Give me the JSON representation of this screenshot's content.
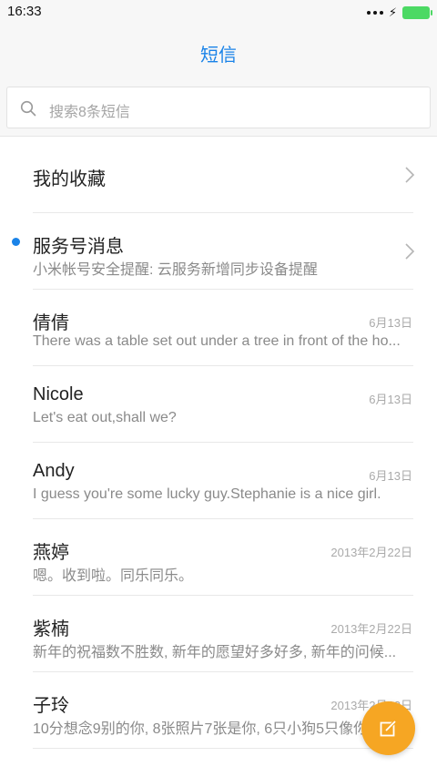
{
  "status_bar": {
    "time": "16:33",
    "battery_color": "#4cd964"
  },
  "header": {
    "title": "短信",
    "accent_color": "#1a83e8"
  },
  "search": {
    "placeholder": "搜索8条短信"
  },
  "folders": [
    {
      "name": "我的收藏"
    },
    {
      "name": "服务号消息",
      "preview": "小米帐号安全提醒: 云服务新增同步设备提醒",
      "unread": true
    }
  ],
  "threads": [
    {
      "name": "倩倩",
      "preview": "There was a table set out under a tree in front of the ho...",
      "date": "6月13日"
    },
    {
      "name": "Nicole",
      "preview": "Let's eat out,shall we?",
      "date": "6月13日"
    },
    {
      "name": "Andy",
      "preview": "I guess you're some lucky guy.Stephanie is a nice girl.",
      "date": "6月13日"
    },
    {
      "name": "燕婷",
      "preview": "嗯。收到啦。同乐同乐。",
      "date": "2013年2月22日"
    },
    {
      "name": "紫楠",
      "preview": "新年的祝福数不胜数, 新年的愿望好多好多, 新年的问候...",
      "date": "2013年2月22日"
    },
    {
      "name": "子玲",
      "preview": "10分想念9别的你, 8张照片7张是你, 6只小狗5只像你...",
      "date": "2013年2月22日"
    }
  ],
  "fab": {
    "icon": "compose-icon",
    "color": "#f6a623"
  }
}
